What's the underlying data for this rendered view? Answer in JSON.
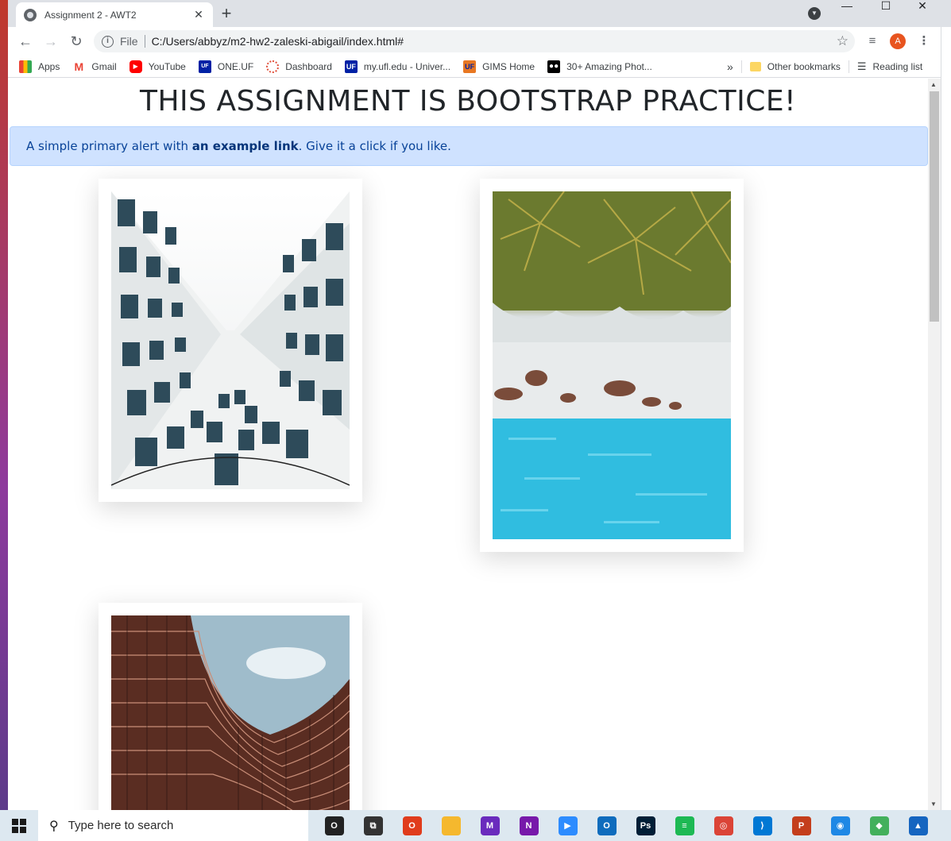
{
  "browser": {
    "tab_title": "Assignment 2 - AWT2",
    "tab_close": "✕",
    "new_tab": "+",
    "profile_letter": "A",
    "url_scheme_label": "File",
    "url": "C:/Users/abbyz/m2-hw2-zaleski-abigail/index.html#",
    "window_controls": {
      "minimize": "—",
      "maximize": "☐",
      "close": "✕"
    }
  },
  "bookmarks": {
    "items": [
      {
        "label": "Apps",
        "icon": "apps-grid-icon",
        "color": "#ea4335"
      },
      {
        "label": "Gmail",
        "icon": "gmail-icon",
        "color": "#ea4335"
      },
      {
        "label": "YouTube",
        "icon": "youtube-icon",
        "color": "#ff0000"
      },
      {
        "label": "ONE.UF",
        "icon": "one-uf-icon",
        "color": "#0021a5"
      },
      {
        "label": "Dashboard",
        "icon": "dashboard-icon",
        "color": "#e04e39"
      },
      {
        "label": "my.ufl.edu - Univer...",
        "icon": "uf-icon",
        "color": "#0021a5"
      },
      {
        "label": "GIMS Home",
        "icon": "gims-icon",
        "color": "#e87722"
      },
      {
        "label": "30+ Amazing Phot...",
        "icon": "medium-icon",
        "color": "#000000"
      }
    ],
    "overflow": "»",
    "other": "Other bookmarks",
    "reading_list": "Reading list"
  },
  "page": {
    "heading": "THIS ASSIGNMENT IS BOOTSTRAP PRACTICE!",
    "alert": {
      "prefix": "A simple primary alert with ",
      "link": "an example link",
      "suffix": ". Give it a click if you like."
    }
  },
  "taskbar": {
    "search_placeholder": "Type here to search",
    "apps": [
      {
        "name": "cortana-icon",
        "color": "#222222",
        "glyph": "O"
      },
      {
        "name": "task-view-icon",
        "color": "#333333",
        "glyph": "⧉"
      },
      {
        "name": "office-icon",
        "color": "#e03c1c",
        "glyph": "O"
      },
      {
        "name": "file-explorer-icon",
        "color": "#f5b82e",
        "glyph": ""
      },
      {
        "name": "visual-studio-icon",
        "color": "#6a2bbd",
        "glyph": "M"
      },
      {
        "name": "onenote-icon",
        "color": "#7719aa",
        "glyph": "N"
      },
      {
        "name": "zoom-icon",
        "color": "#2d8cff",
        "glyph": "▶"
      },
      {
        "name": "outlook-icon",
        "color": "#0f6cbd",
        "glyph": "O"
      },
      {
        "name": "photoshop-icon",
        "color": "#001e36",
        "glyph": "Ps"
      },
      {
        "name": "spotify-icon",
        "color": "#1db954",
        "glyph": "≡"
      },
      {
        "name": "chrome-icon",
        "color": "#db4437",
        "glyph": "◎"
      },
      {
        "name": "vscode-icon",
        "color": "#0078d4",
        "glyph": "⟩"
      },
      {
        "name": "powerpoint-icon",
        "color": "#c43e1c",
        "glyph": "P"
      },
      {
        "name": "camera-app-icon",
        "color": "#1e88e5",
        "glyph": "◉"
      },
      {
        "name": "sourcetree-icon",
        "color": "#43b05c",
        "glyph": "◆"
      },
      {
        "name": "photos-icon",
        "color": "#1565c0",
        "glyph": "▲"
      }
    ]
  }
}
